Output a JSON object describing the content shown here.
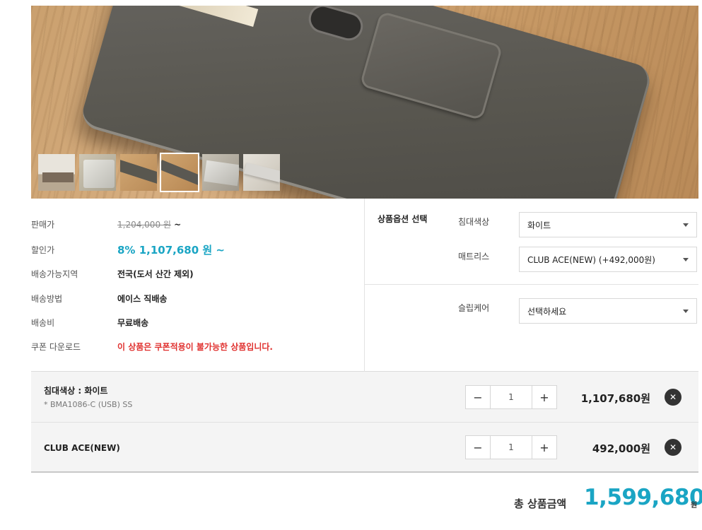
{
  "gallery": {
    "thumbnails": [
      "thumb-1",
      "thumb-2",
      "thumb-3",
      "thumb-4",
      "thumb-5",
      "thumb-6"
    ],
    "active_index": 3
  },
  "specs": {
    "list_price_label": "판매가",
    "list_price": "1,204,000 원",
    "list_price_suffix": "~",
    "sale_label": "할인가",
    "sale_price": "8% 1,107,680 원 ~",
    "region_label": "배송가능지역",
    "region": "전국(도서 산간 제외)",
    "method_label": "배송방법",
    "method": "에이스 직배송",
    "fee_label": "배송비",
    "fee": "무료배송",
    "coupon_label": "쿠폰 다운로드",
    "coupon": "이 상품은 쿠폰적용이 불가능한 상품입니다."
  },
  "options": {
    "title": "상품옵션 선택",
    "bed_color_label": "침대색상",
    "bed_color_value": "화이트",
    "mattress_label": "매트리스",
    "mattress_value": "CLUB ACE(NEW) (+492,000원)",
    "sleep_care_label": "슬립케어",
    "sleep_care_value": "선택하세요"
  },
  "selected": [
    {
      "name": "침대색상 : 화이트",
      "sub": "* BMA1086-C (USB) SS",
      "qty": "1",
      "price": "1,107,680원",
      "minus": "−",
      "plus": "+",
      "remove": "✕"
    },
    {
      "name": "CLUB ACE(NEW)",
      "qty": "1",
      "price": "492,000원",
      "minus": "−",
      "plus": "+",
      "remove": "✕"
    }
  ],
  "total": {
    "label": "총 상품금액",
    "amount": "1,599,680",
    "unit": "원"
  }
}
